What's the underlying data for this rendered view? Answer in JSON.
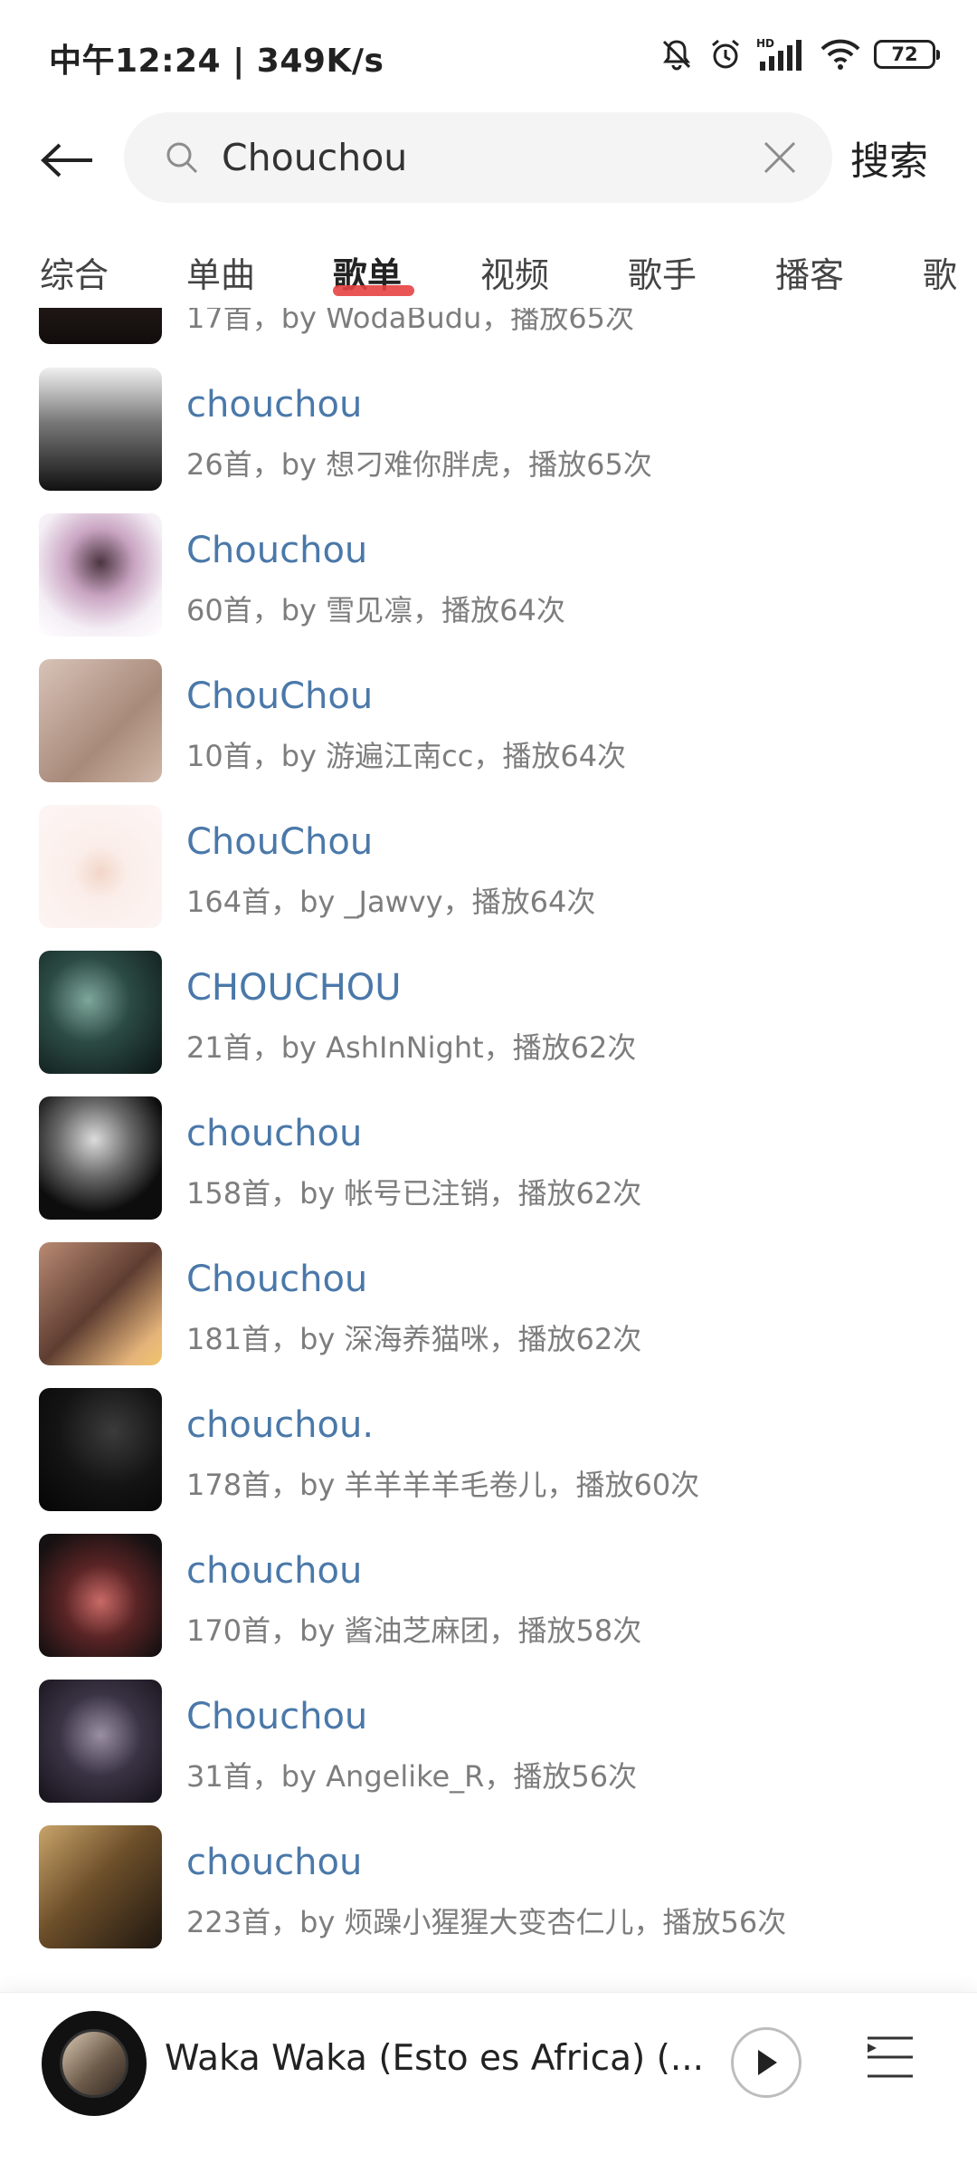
{
  "status_bar": {
    "time_text": "中午12:24 | 349K/s",
    "battery_level": "72",
    "icons": [
      "mute-icon",
      "alarm-icon",
      "hd-signal-icon",
      "wifi-icon",
      "battery-icon"
    ]
  },
  "search": {
    "query": "Chouchou",
    "button_label": "搜索"
  },
  "tabs": [
    {
      "label": "综合"
    },
    {
      "label": "单曲"
    },
    {
      "label": "歌单"
    },
    {
      "label": "视频"
    },
    {
      "label": "歌手"
    },
    {
      "label": "播客"
    },
    {
      "label": "歌"
    }
  ],
  "active_tab_index": 2,
  "accent_color": "#e74343",
  "link_color": "#4a78a9",
  "results": [
    {
      "title": "",
      "subtitle": "17首，by WodaBudu，播放65次"
    },
    {
      "title": "chouchou",
      "subtitle": "26首，by 想刁难你胖虎，播放65次"
    },
    {
      "title": "Chouchou",
      "subtitle": "60首，by 雪见凛，播放64次"
    },
    {
      "title": "ChouChou",
      "subtitle": "10首，by 游遍江南cc，播放64次"
    },
    {
      "title": "ChouChou",
      "subtitle": "164首，by _Jawvy，播放64次"
    },
    {
      "title": "CHOUCHOU",
      "subtitle": "21首，by AshInNight，播放62次"
    },
    {
      "title": "chouchou",
      "subtitle": "158首，by 帐号已注销，播放62次"
    },
    {
      "title": "Chouchou",
      "subtitle": "181首，by 深海养猫咪，播放62次"
    },
    {
      "title": "chouchou.",
      "subtitle": "178首，by 羊羊羊羊毛卷儿，播放60次"
    },
    {
      "title": "chouchou",
      "subtitle": "170首，by 酱油芝麻团，播放58次"
    },
    {
      "title": "Chouchou",
      "subtitle": "31首，by Angelike_R，播放56次"
    },
    {
      "title": "chouchou",
      "subtitle": "223首，by 烦躁小猩猩大变杏仁儿，播放56次"
    }
  ],
  "player": {
    "title": "Waka Waka (Esto es Africa) (..."
  }
}
